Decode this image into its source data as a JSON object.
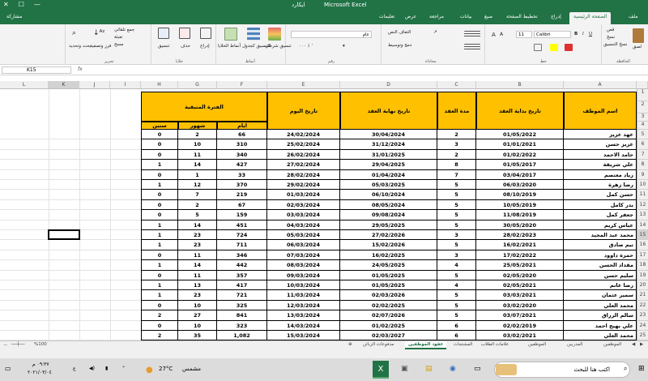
{
  "window": {
    "title_file": "Microsoft Excel",
    "title_name": "ایکارد",
    "share": "مشاركة"
  },
  "tabs": [
    "ملف",
    "الصفحة الرئيسية",
    "إدراج",
    "تخطيط الصفحة",
    "صيغ",
    "بيانات",
    "مراجعة",
    "عرض",
    "تعليمات"
  ],
  "ribbon": {
    "font_name": "Calibri",
    "font_size": "11",
    "number_format": "عام",
    "clipboard": [
      "لصق",
      "قص",
      "نسخ",
      "نسخ التنسيق"
    ],
    "groups": [
      "الحافظة",
      "خط",
      "محاذاة",
      "رقم",
      "أنماط",
      "خلايا",
      "تحرير"
    ],
    "alignment": [
      "التفاف النص",
      "دمج وتوسيط"
    ],
    "styles": [
      "تنسيق شرطي",
      "التنسيق كجدول",
      "أنماط الخلايا"
    ],
    "cells": [
      "إدراج",
      "حذف",
      "تنسيق"
    ],
    "editing": [
      "جمع تلقائي",
      "تعبئة",
      "مسح",
      "فرز وتصفية",
      "بحث وتحديد"
    ]
  },
  "formula_bar": {
    "name_box": "K15",
    "fx": "fx",
    "value": ""
  },
  "columns": [
    "A",
    "B",
    "C",
    "D",
    "E",
    "F",
    "G",
    "H",
    "I",
    "J",
    "K",
    "L"
  ],
  "headers": {
    "name": "اسم الموظف",
    "start": "تاريخ بداية العقد",
    "duration": "مدة العقد",
    "end": "تاريخ نهاية العقد",
    "today": "تاريخ اليوم",
    "remaining": "الفترة المتبقية",
    "days": "ايام",
    "months": "شهور",
    "years": "سنين"
  },
  "rows": [
    {
      "r": "5",
      "name": "عهد عزيز",
      "start": "01/05/2022",
      "dur": "2",
      "end": "30/04/2024",
      "today": "24/02/2024",
      "days": "66",
      "months": "2",
      "years": "0"
    },
    {
      "r": "6",
      "name": "عزيز حسن",
      "start": "01/01/2021",
      "dur": "3",
      "end": "31/12/2024",
      "today": "25/02/2024",
      "days": "310",
      "months": "10",
      "years": "0"
    },
    {
      "r": "7",
      "name": "حامد الاحمد",
      "start": "01/02/2022",
      "dur": "2",
      "end": "31/01/2025",
      "today": "26/02/2024",
      "days": "340",
      "months": "11",
      "years": "0"
    },
    {
      "r": "8",
      "name": "علي شريقة",
      "start": "01/05/2017",
      "dur": "8",
      "end": "29/04/2025",
      "today": "27/02/2024",
      "days": "427",
      "months": "14",
      "years": "1"
    },
    {
      "r": "9",
      "name": "زياد معتصم",
      "start": "03/04/2017",
      "dur": "7",
      "end": "01/04/2024",
      "today": "28/02/2024",
      "days": "33",
      "months": "1",
      "years": "0"
    },
    {
      "r": "10",
      "name": "رضا زهرة",
      "start": "06/03/2020",
      "dur": "5",
      "end": "05/03/2025",
      "today": "29/02/2024",
      "days": "370",
      "months": "12",
      "years": "1"
    },
    {
      "r": "11",
      "name": "حسن كمل",
      "start": "08/10/2019",
      "dur": "5",
      "end": "06/10/2024",
      "today": "01/03/2024",
      "days": "219",
      "months": "7",
      "years": "0"
    },
    {
      "r": "12",
      "name": "بدر كامل",
      "start": "10/05/2019",
      "dur": "5",
      "end": "08/05/2024",
      "today": "02/03/2024",
      "days": "67",
      "months": "2",
      "years": "0"
    },
    {
      "r": "13",
      "name": "جعفر كمل",
      "start": "11/08/2019",
      "dur": "5",
      "end": "09/08/2024",
      "today": "03/03/2024",
      "days": "159",
      "months": "5",
      "years": "0"
    },
    {
      "r": "14",
      "name": "عباس كريم",
      "start": "30/05/2020",
      "dur": "5",
      "end": "29/05/2025",
      "today": "04/03/2024",
      "days": "451",
      "months": "14",
      "years": "1"
    },
    {
      "r": "15",
      "name": "محمد عبد المجيد",
      "start": "28/02/2023",
      "dur": "3",
      "end": "27/02/2026",
      "today": "05/03/2024",
      "days": "724",
      "months": "23",
      "years": "1"
    },
    {
      "r": "16",
      "name": "تيم صادق",
      "start": "16/02/2021",
      "dur": "5",
      "end": "15/02/2026",
      "today": "06/03/2024",
      "days": "711",
      "months": "23",
      "years": "1"
    },
    {
      "r": "17",
      "name": "حمزة داوود",
      "start": "17/02/2022",
      "dur": "3",
      "end": "16/02/2025",
      "today": "07/03/2024",
      "days": "346",
      "months": "11",
      "years": "0"
    },
    {
      "r": "18",
      "name": "مقداد الحسن",
      "start": "25/05/2021",
      "dur": "4",
      "end": "24/05/2025",
      "today": "08/03/2024",
      "days": "442",
      "months": "14",
      "years": "1"
    },
    {
      "r": "19",
      "name": "سليم حسن",
      "start": "02/05/2020",
      "dur": "5",
      "end": "01/05/2025",
      "today": "09/03/2024",
      "days": "357",
      "months": "11",
      "years": "0"
    },
    {
      "r": "20",
      "name": "رضا غانم",
      "start": "02/05/2021",
      "dur": "4",
      "end": "01/05/2025",
      "today": "10/03/2024",
      "days": "417",
      "months": "13",
      "years": "1"
    },
    {
      "r": "21",
      "name": "سمير عثمان",
      "start": "03/03/2021",
      "dur": "5",
      "end": "02/03/2026",
      "today": "11/03/2024",
      "days": "721",
      "months": "23",
      "years": "1"
    },
    {
      "r": "22",
      "name": "محمد العلي",
      "start": "03/02/2020",
      "dur": "5",
      "end": "02/02/2025",
      "today": "12/03/2024",
      "days": "325",
      "months": "10",
      "years": "0"
    },
    {
      "r": "23",
      "name": "سالم الرزاق",
      "start": "03/07/2021",
      "dur": "5",
      "end": "02/07/2026",
      "today": "13/03/2024",
      "days": "841",
      "months": "27",
      "years": "2"
    },
    {
      "r": "24",
      "name": "علي بهيج احمد",
      "start": "02/02/2019",
      "dur": "6",
      "end": "01/02/2025",
      "today": "14/03/2024",
      "days": "323",
      "months": "10",
      "years": "0"
    },
    {
      "r": "25",
      "name": "محمد العلي",
      "start": "03/02/2021",
      "dur": "6",
      "end": "02/03/2027",
      "today": "15/03/2024",
      "days": "1,082",
      "months": "35",
      "years": "2"
    }
  ],
  "extra_rows": [
    "1",
    "2",
    "3",
    "4"
  ],
  "sheet_tabs": [
    "الموظفين",
    "المدربين",
    "الموظفين",
    "علامات الطلاب",
    "المشتجات",
    "عقود الموظفين",
    "مدفوعات الزبائن"
  ],
  "active_sheet": "عقود الموظفين",
  "status": {
    "zoom": "%100"
  },
  "taskbar": {
    "search": "اكتب هنا للبحث",
    "weather_temp": "27°C",
    "weather_text": "مشمس",
    "time": "٠٩:٣٧ م",
    "date": "٢٠٢١/٠٣/٠٤"
  }
}
